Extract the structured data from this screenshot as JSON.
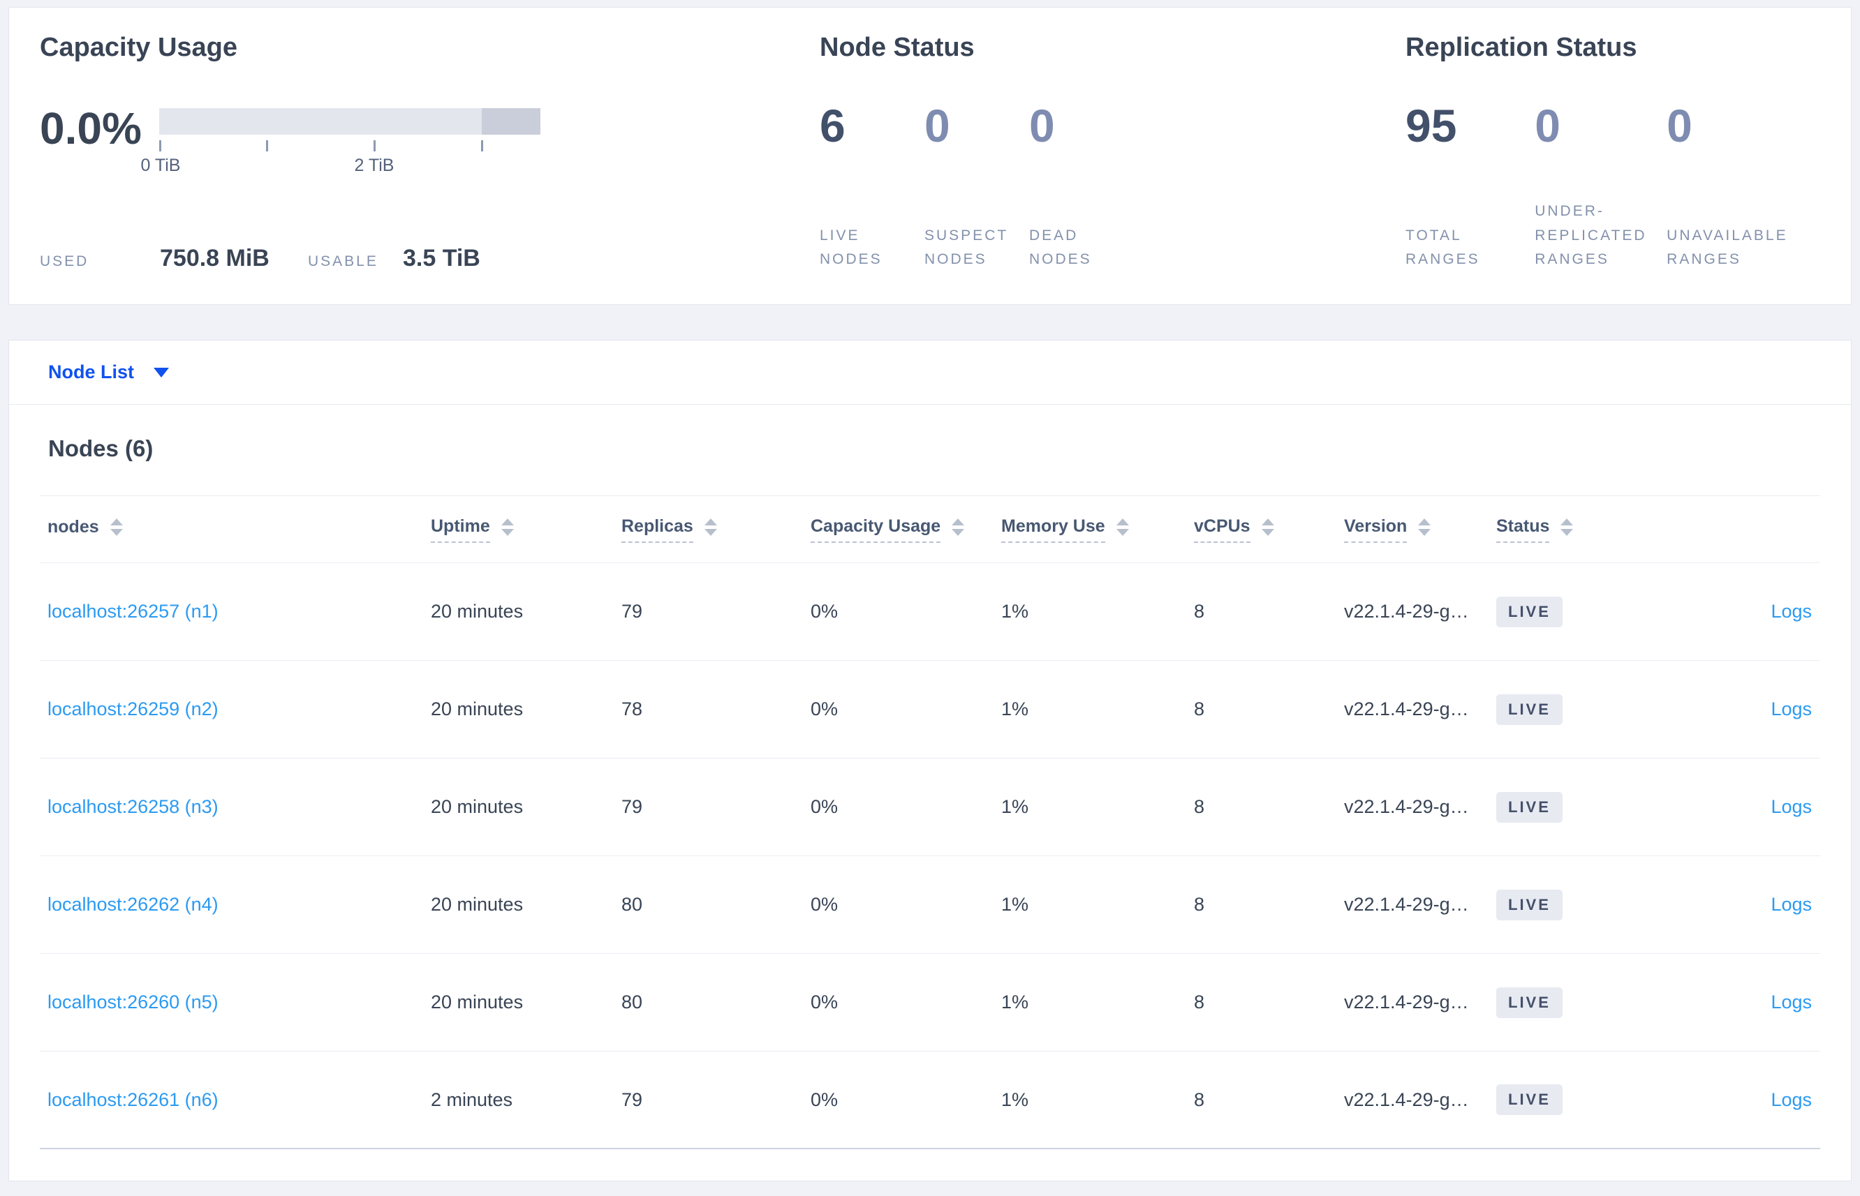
{
  "summary": {
    "capacity": {
      "title": "Capacity Usage",
      "percent": "0.0%",
      "ticks": [
        "0 TiB",
        "2 TiB"
      ],
      "used_label": "USED",
      "used_value": "750.8 MiB",
      "usable_label": "USABLE",
      "usable_value": "3.5 TiB"
    },
    "node_status": {
      "title": "Node Status",
      "stats": [
        {
          "value": "6",
          "label": "LIVE NODES"
        },
        {
          "value": "0",
          "label": "SUSPECT NODES"
        },
        {
          "value": "0",
          "label": "DEAD NODES"
        }
      ]
    },
    "replication": {
      "title": "Replication Status",
      "stats": [
        {
          "value": "95",
          "label": "TOTAL RANGES"
        },
        {
          "value": "0",
          "label": "UNDER-REPLICATED RANGES"
        },
        {
          "value": "0",
          "label": "UNAVAILABLE RANGES"
        }
      ]
    }
  },
  "node_list": {
    "selector_label": "Node List",
    "table_title": "Nodes (6)",
    "columns": [
      {
        "label": "nodes"
      },
      {
        "label": "Uptime"
      },
      {
        "label": "Replicas"
      },
      {
        "label": "Capacity Usage"
      },
      {
        "label": "Memory Use"
      },
      {
        "label": "vCPUs"
      },
      {
        "label": "Version"
      },
      {
        "label": "Status"
      }
    ],
    "rows": [
      {
        "name": "localhost:26257 (n1)",
        "uptime": "20 minutes",
        "replicas": "79",
        "capacity": "0%",
        "memory": "1%",
        "vcpus": "8",
        "version": "v22.1.4-29-g…",
        "status": "LIVE",
        "logs": "Logs"
      },
      {
        "name": "localhost:26259 (n2)",
        "uptime": "20 minutes",
        "replicas": "78",
        "capacity": "0%",
        "memory": "1%",
        "vcpus": "8",
        "version": "v22.1.4-29-g…",
        "status": "LIVE",
        "logs": "Logs"
      },
      {
        "name": "localhost:26258 (n3)",
        "uptime": "20 minutes",
        "replicas": "79",
        "capacity": "0%",
        "memory": "1%",
        "vcpus": "8",
        "version": "v22.1.4-29-g…",
        "status": "LIVE",
        "logs": "Logs"
      },
      {
        "name": "localhost:26262 (n4)",
        "uptime": "20 minutes",
        "replicas": "80",
        "capacity": "0%",
        "memory": "1%",
        "vcpus": "8",
        "version": "v22.1.4-29-g…",
        "status": "LIVE",
        "logs": "Logs"
      },
      {
        "name": "localhost:26260 (n5)",
        "uptime": "20 minutes",
        "replicas": "80",
        "capacity": "0%",
        "memory": "1%",
        "vcpus": "8",
        "version": "v22.1.4-29-g…",
        "status": "LIVE",
        "logs": "Logs"
      },
      {
        "name": "localhost:26261 (n6)",
        "uptime": "2 minutes",
        "replicas": "79",
        "capacity": "0%",
        "memory": "1%",
        "vcpus": "8",
        "version": "v22.1.4-29-g…",
        "status": "LIVE",
        "logs": "Logs"
      }
    ]
  },
  "colors": {
    "page_bg": "#f0f2f7",
    "primary_blue": "#1152ee",
    "link_blue": "#2b9af2",
    "dark_text": "#394455",
    "muted_stat": "#7f8cb1",
    "label_gray": "#8391ab",
    "badge_bg": "#e7eaf1",
    "bar_light": "#e3e6ed",
    "bar_dark": "#c9ceda"
  }
}
